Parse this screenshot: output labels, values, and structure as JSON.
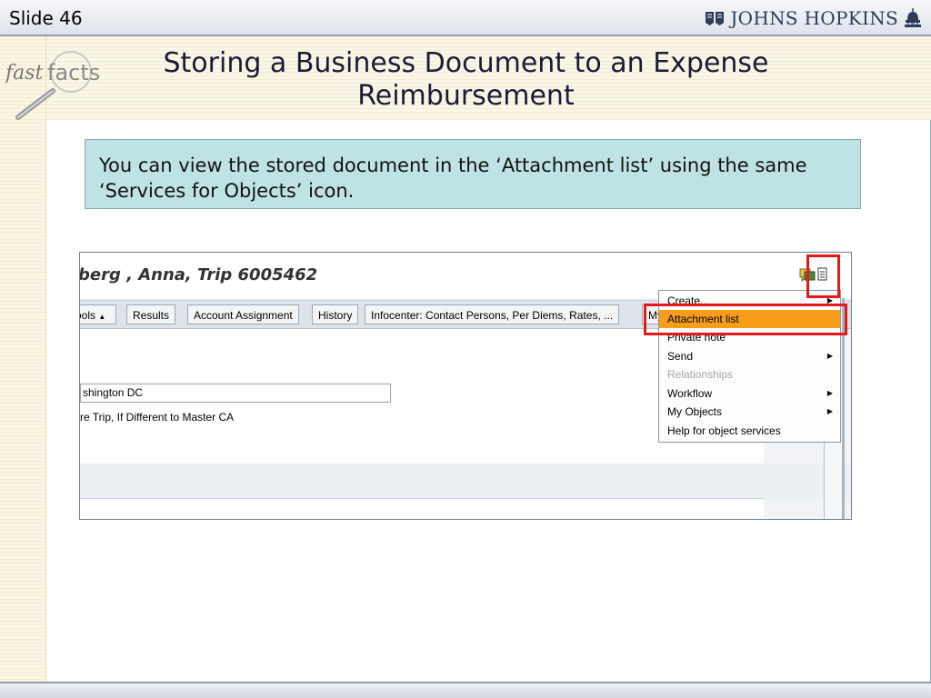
{
  "header": {
    "slide_label": "Slide 46",
    "logo_text": "JOHNS HOPKINS"
  },
  "brand": {
    "fast": "fast",
    "facts": "facts"
  },
  "title": {
    "line1": "Storing a Business Document to an Expense",
    "line2": "Reimbursement"
  },
  "note": {
    "text": "You can view the stored document in the ‘Attachment list’ using the same ‘Services for Objects’ icon."
  },
  "sap": {
    "title": "berg , Anna, Trip 6005462",
    "tabs": [
      {
        "label": "ools"
      },
      {
        "label": "Results"
      },
      {
        "label": "Account Assignment"
      },
      {
        "label": "History"
      },
      {
        "label": "Infocenter: Contact Persons, Per Diems, Rates, ..."
      },
      {
        "label": "My"
      }
    ],
    "city_value": "shington DC",
    "field_label": "re Trip, If Different to Master CA",
    "menu": [
      {
        "label": "Create...",
        "submenu": true,
        "state": "normal"
      },
      {
        "label": "Attachment list",
        "submenu": false,
        "state": "active"
      },
      {
        "label": "Private note",
        "submenu": false,
        "state": "normal"
      },
      {
        "label": "Send",
        "submenu": true,
        "state": "normal"
      },
      {
        "label": "Relationships",
        "submenu": false,
        "state": "disabled"
      },
      {
        "label": "Workflow",
        "submenu": true,
        "state": "normal"
      },
      {
        "label": "My Objects",
        "submenu": true,
        "state": "normal"
      },
      {
        "label": "Help for object services",
        "submenu": false,
        "state": "normal"
      }
    ]
  },
  "colors": {
    "highlight": "#e51919",
    "menu_active": "#f79d1a",
    "note_bg": "#bfe3e4"
  }
}
